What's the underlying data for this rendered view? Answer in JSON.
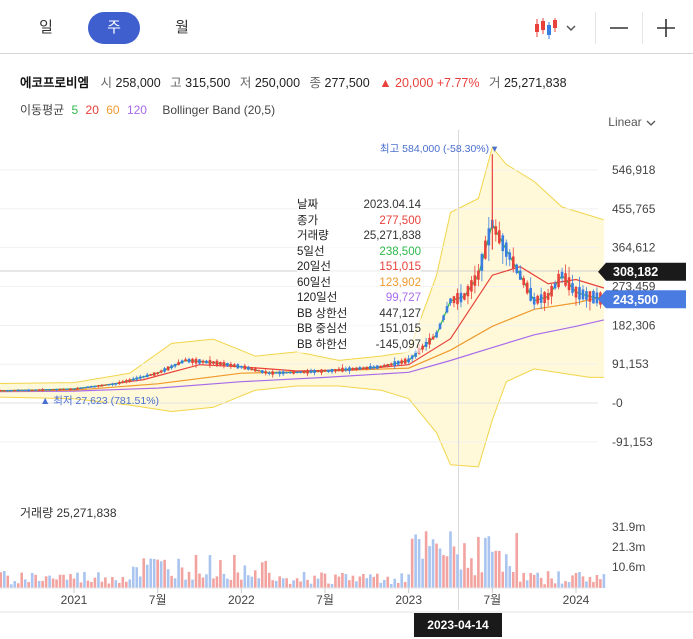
{
  "tabs": {
    "day": "일",
    "week": "주",
    "month": "월",
    "active": "week"
  },
  "toolbar": {
    "chart_type_icon": "candlestick-icon",
    "dropdown_icon": "chevron-down-icon",
    "zoom_out_icon": "minus-icon",
    "zoom_in_icon": "plus-icon"
  },
  "quote": {
    "name": "에코프로비엠",
    "open_label": "시",
    "open": "258,000",
    "high_label": "고",
    "high": "315,500",
    "low_label": "저",
    "low": "250,000",
    "close_label": "종",
    "close": "277,500",
    "change": "▲ 20,000 +7.77%",
    "volume_label": "거",
    "volume": "25,271,838"
  },
  "indicators": {
    "ma_label": "이동평균",
    "ma5": "5",
    "ma20": "20",
    "ma60": "60",
    "ma120": "120",
    "bb_label": "Bollinger Band (20,5)"
  },
  "scale_label": "Linear",
  "tooltip": [
    {
      "label": "날짜",
      "value": "2023.04.14",
      "color": "#333333"
    },
    {
      "label": "종가",
      "value": "277,500",
      "color": "#e8413b"
    },
    {
      "label": "거래량",
      "value": "25,271,838",
      "color": "#333333"
    },
    {
      "label": "5일선",
      "value": "238,500",
      "color": "#2db84d"
    },
    {
      "label": "20일선",
      "value": "151,015",
      "color": "#e8413b"
    },
    {
      "label": "60일선",
      "value": "123,902",
      "color": "#f09a2e"
    },
    {
      "label": "120일선",
      "value": "99,727",
      "color": "#a86bea"
    },
    {
      "label": "BB 상한선",
      "value": "447,127",
      "color": "#333333"
    },
    {
      "label": "BB 중심선",
      "value": "151,015",
      "color": "#333333"
    },
    {
      "label": "BB 하한선",
      "value": "-145,097",
      "color": "#333333"
    }
  ],
  "volume_title": "거래량 25,271,838",
  "hover_date": "2023-04-14",
  "colors": {
    "up": "#e8413b",
    "down": "#3a7de0",
    "ma5": "#2db84d",
    "ma20": "#e8413b",
    "ma60": "#f09a2e",
    "ma120": "#a86bea",
    "bb_fill": "#fff9d9",
    "bb_line": "#f2d54a",
    "accent": "#3f5fcf"
  },
  "chart_data": {
    "type": "line",
    "y_ticks": [
      "546,918",
      "455,765",
      "364,612",
      "273,459",
      "182,306",
      "91,153",
      "-0",
      "-91,153"
    ],
    "y_tick_values": [
      546918,
      455765,
      364612,
      273459,
      182306,
      91153,
      0,
      -91153
    ],
    "ylim": [
      -145000,
      600000
    ],
    "x_tick_labels": [
      "2021",
      "7월",
      "2022",
      "7월",
      "2023",
      "7월",
      "2024"
    ],
    "x_tick_dates": [
      "2021-01",
      "2021-07",
      "2022-01",
      "2022-07",
      "2023-01",
      "2023-07",
      "2024-01"
    ],
    "xlim": [
      "2020-06",
      "2024-03"
    ],
    "max_annotation": {
      "label": "최고 584,000 (-58.30%)",
      "value": 584000,
      "date": "2023-07-24"
    },
    "min_annotation": {
      "label": "▲ 최저 27,623 (781.51%)",
      "value": 27623,
      "date": "2020-06"
    },
    "price_labels": [
      {
        "text": "308,182",
        "value": 308182,
        "style": "dark"
      },
      {
        "text": "243,500",
        "value": 243500,
        "style": "blue"
      }
    ],
    "series": [
      {
        "name": "5",
        "x": [
          "2020-06",
          "2020-10",
          "2021-01",
          "2021-04",
          "2021-07",
          "2021-09",
          "2021-11",
          "2022-01",
          "2022-03",
          "2022-05",
          "2022-07",
          "2022-09",
          "2022-11",
          "2023-01",
          "2023-03",
          "2023-04",
          "2023-05",
          "2023-06",
          "2023-07",
          "2023-08",
          "2023-09",
          "2023-10",
          "2023-11",
          "2023-12",
          "2024-01",
          "2024-02",
          "2024-03"
        ],
        "values": [
          28000,
          30000,
          33000,
          45000,
          70000,
          100000,
          95000,
          85000,
          70000,
          72000,
          75000,
          80000,
          85000,
          100000,
          160000,
          240000,
          250000,
          300000,
          420000,
          360000,
          300000,
          240000,
          250000,
          300000,
          260000,
          250000,
          243500
        ]
      },
      {
        "name": "20",
        "x": [
          "2020-06",
          "2021-01",
          "2021-06",
          "2021-10",
          "2022-01",
          "2022-05",
          "2022-09",
          "2023-01",
          "2023-04",
          "2023-07",
          "2023-09",
          "2023-11",
          "2024-01",
          "2024-03"
        ],
        "values": [
          28000,
          32000,
          55000,
          90000,
          85000,
          75000,
          78000,
          90000,
          151015,
          300000,
          320000,
          280000,
          290000,
          270000
        ]
      },
      {
        "name": "60",
        "x": [
          "2020-06",
          "2021-01",
          "2021-07",
          "2022-01",
          "2022-07",
          "2023-01",
          "2023-04",
          "2023-07",
          "2023-10",
          "2024-01",
          "2024-03"
        ],
        "values": [
          27000,
          30000,
          45000,
          70000,
          75000,
          82000,
          123902,
          180000,
          220000,
          235000,
          250000
        ]
      },
      {
        "name": "120",
        "x": [
          "2020-06",
          "2021-01",
          "2021-07",
          "2022-01",
          "2022-07",
          "2023-01",
          "2023-04",
          "2023-07",
          "2023-10",
          "2024-01",
          "2024-03"
        ],
        "values": [
          26000,
          28000,
          35000,
          50000,
          60000,
          72000,
          99727,
          130000,
          160000,
          180000,
          195000
        ]
      }
    ],
    "bollinger": {
      "x": [
        "2020-06",
        "2021-01",
        "2021-05",
        "2021-08",
        "2021-11",
        "2022-02",
        "2022-05",
        "2022-08",
        "2022-11",
        "2023-01",
        "2023-03",
        "2023-04",
        "2023-06",
        "2023-07",
        "2023-08",
        "2023-10",
        "2023-12",
        "2024-02",
        "2024-03"
      ],
      "upper": [
        45000,
        48000,
        70000,
        140000,
        150000,
        110000,
        120000,
        100000,
        110000,
        120000,
        300000,
        447127,
        480000,
        600000,
        560000,
        520000,
        460000,
        440000,
        430000
      ],
      "lower": [
        15000,
        10000,
        -5000,
        -20000,
        -10000,
        30000,
        40000,
        40000,
        30000,
        10000,
        -70000,
        -145097,
        -150000,
        -40000,
        50000,
        80000,
        70000,
        60000,
        60000
      ]
    },
    "volume": {
      "ticks": [
        "31.9m",
        "21.3m",
        "10.6m"
      ]
    }
  }
}
